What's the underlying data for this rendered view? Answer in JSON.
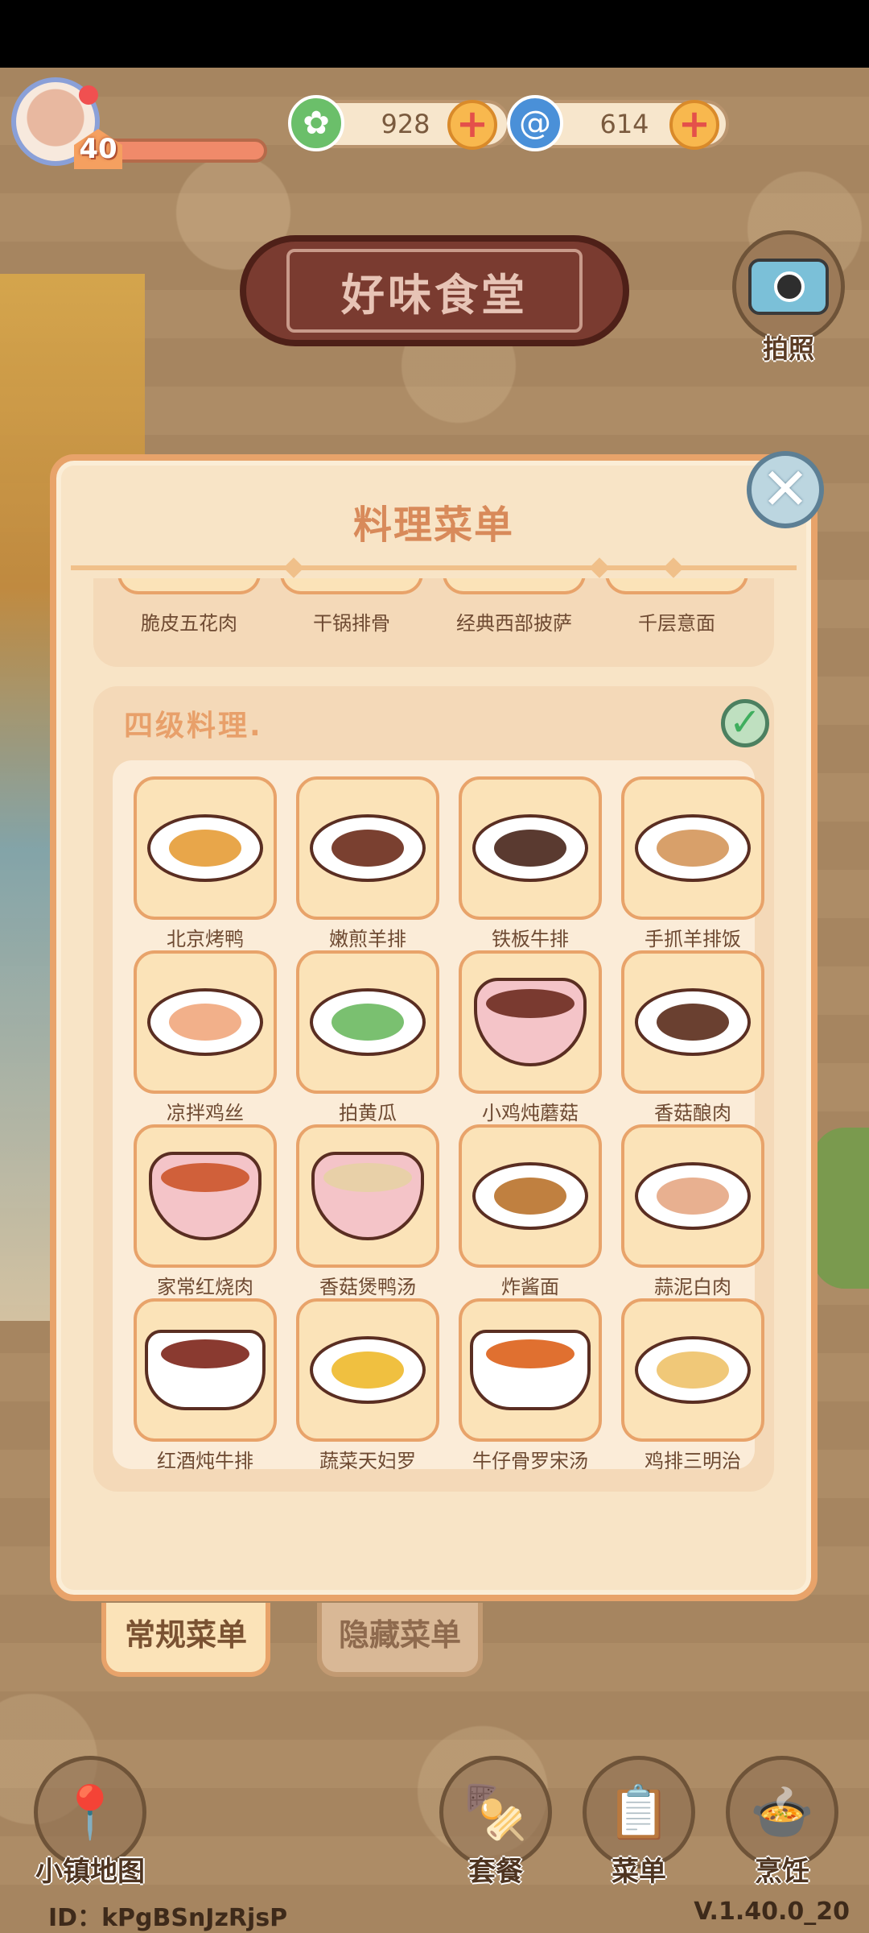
{
  "hud": {
    "level": "40",
    "leaf_count": "928",
    "swirl_count": "614",
    "plus_symbol": "+"
  },
  "restaurant": {
    "name": "好味食堂"
  },
  "camera": {
    "label": "拍照"
  },
  "panel": {
    "title": "料理菜单",
    "close_symbol": "✕",
    "previous_tier_dishes": [
      "脆皮五花肉",
      "干锅排骨",
      "经典西部披萨",
      "千层意面"
    ],
    "tier": {
      "title": "四级料理.",
      "completed_symbol": "✓",
      "dishes": [
        {
          "name": "北京烤鸭",
          "vessel": "plate",
          "color": "#e8a64a"
        },
        {
          "name": "嫩煎羊排",
          "vessel": "plate",
          "color": "#7a4030"
        },
        {
          "name": "铁板牛排",
          "vessel": "plate",
          "color": "#5a3a30"
        },
        {
          "name": "手抓羊排饭",
          "vessel": "plate",
          "color": "#d8a06a"
        },
        {
          "name": "凉拌鸡丝",
          "vessel": "plate",
          "color": "#f2b08a"
        },
        {
          "name": "拍黄瓜",
          "vessel": "plate",
          "color": "#7ac070"
        },
        {
          "name": "小鸡炖蘑菇",
          "vessel": "bowl",
          "color": "#7a3a30"
        },
        {
          "name": "香菇酿肉",
          "vessel": "plate",
          "color": "#6a4030"
        },
        {
          "name": "家常红烧肉",
          "vessel": "bowl",
          "color": "#d0603a"
        },
        {
          "name": "香菇煲鸭汤",
          "vessel": "bowl",
          "color": "#e8d0a8"
        },
        {
          "name": "炸酱面",
          "vessel": "plate",
          "color": "#c08040"
        },
        {
          "name": "蒜泥白肉",
          "vessel": "plate",
          "color": "#e8b090"
        },
        {
          "name": "红酒炖牛排",
          "vessel": "pot",
          "color": "#8a3a30"
        },
        {
          "name": "蔬菜天妇罗",
          "vessel": "plate",
          "color": "#f0c040"
        },
        {
          "name": "牛仔骨罗宋汤",
          "vessel": "pot",
          "color": "#e07030"
        },
        {
          "name": "鸡排三明治",
          "vessel": "plate",
          "color": "#f0c878"
        }
      ]
    }
  },
  "tabs": {
    "regular": "常规菜单",
    "hidden": "隐藏菜单"
  },
  "bottom": {
    "map": "小镇地图",
    "combo": "套餐",
    "menu": "菜单",
    "cook": "烹饪"
  },
  "footer": {
    "id": "ID：kPgBSnJzRjsP",
    "version": "V.1.40.0_20"
  }
}
